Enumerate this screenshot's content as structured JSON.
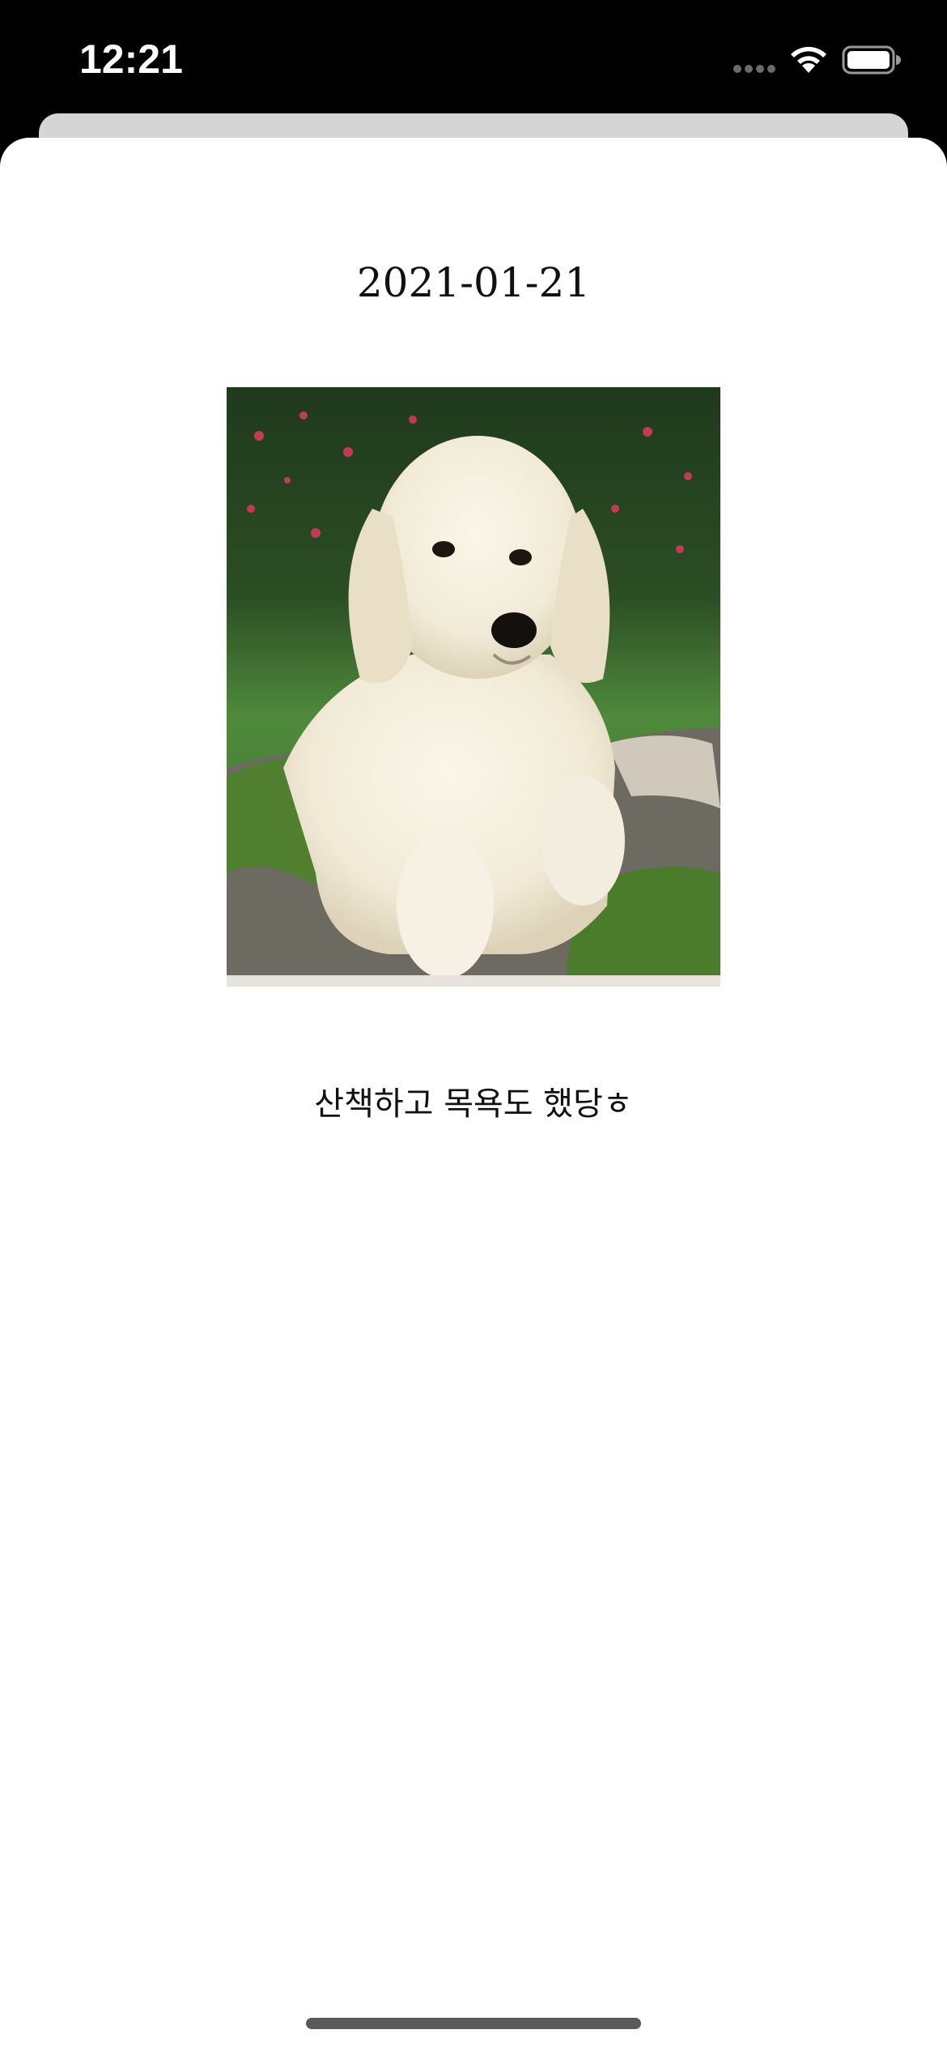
{
  "status_bar": {
    "time": "12:21"
  },
  "entry": {
    "date": "2021-01-21",
    "photo_subject": "puppy-photo",
    "text": "산책하고 목욕도 했당ㅎ"
  },
  "colors": {
    "background": "#000000",
    "sheet": "#ffffff",
    "sheet_behind": "#d5d5d5",
    "text": "#111111"
  }
}
